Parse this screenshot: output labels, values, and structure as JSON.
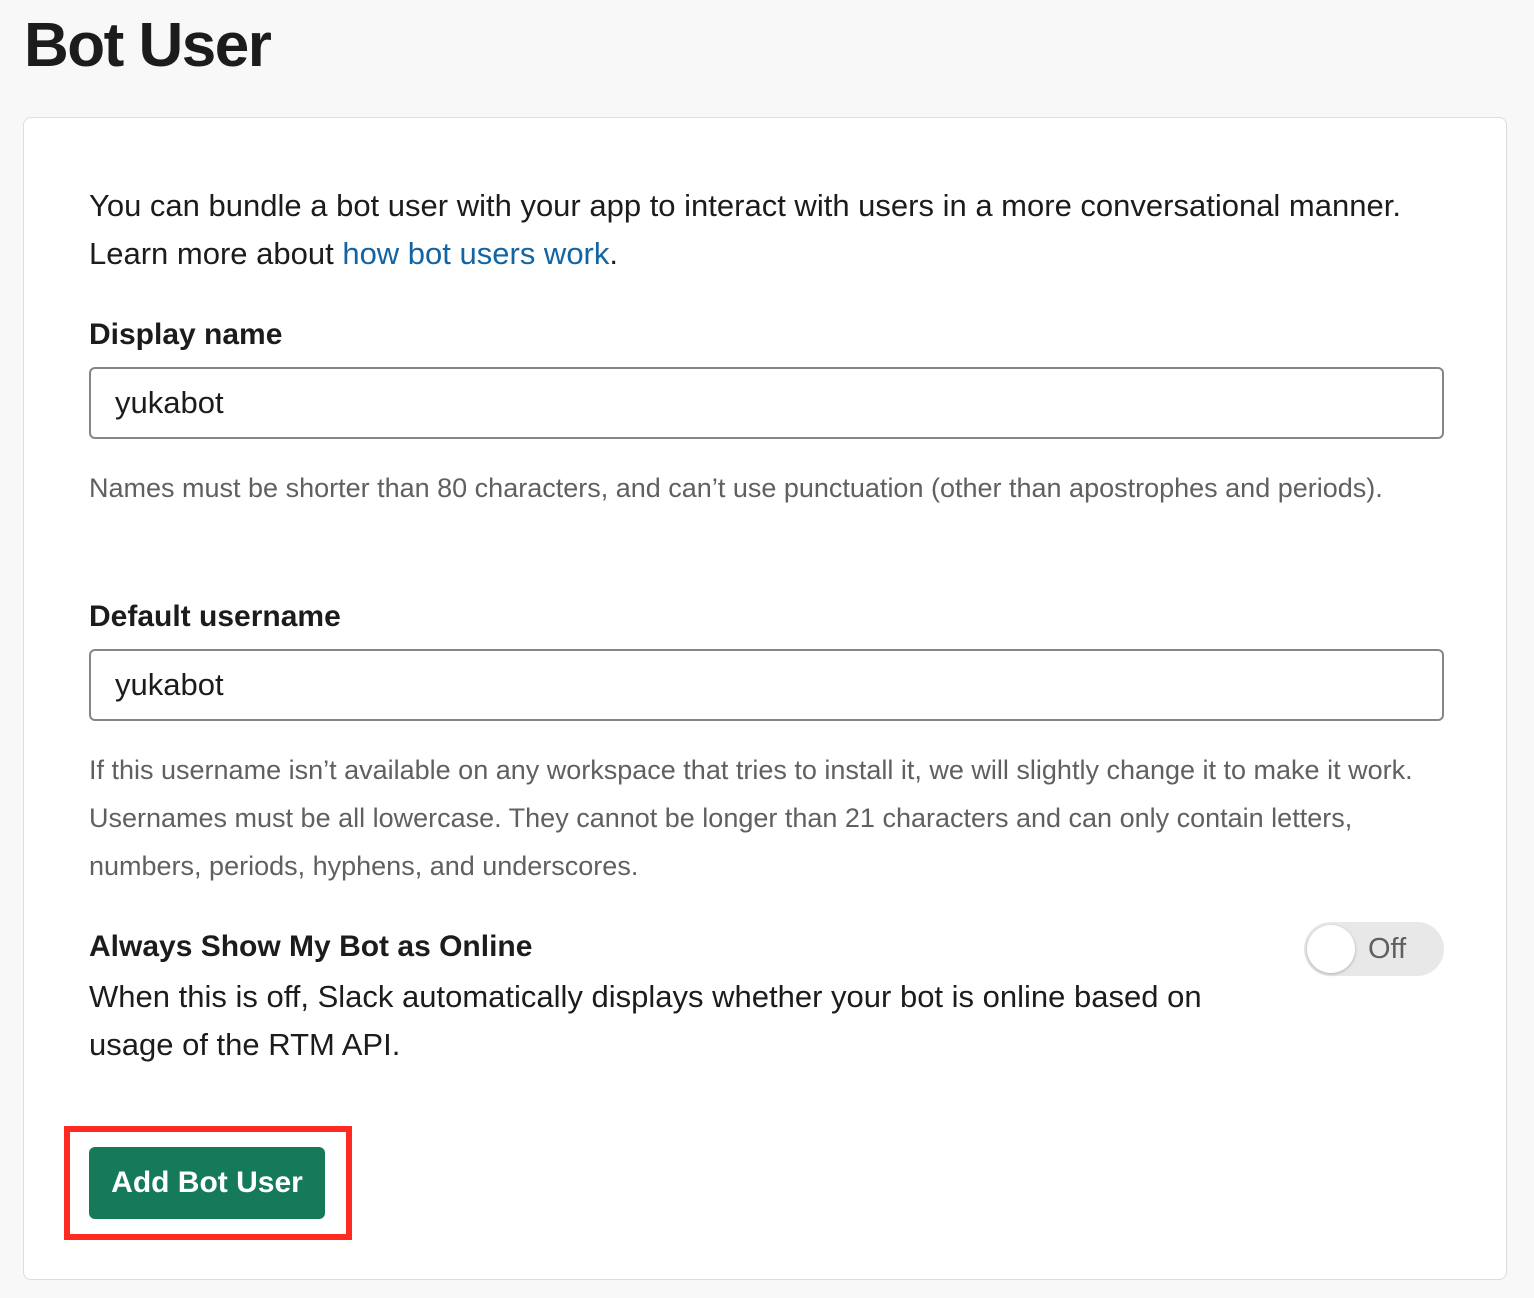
{
  "header": {
    "title": "Bot User"
  },
  "intro": {
    "text_before_link": "You can bundle a bot user with your app to interact with users in a more conversational manner. Learn more about ",
    "link_text": "how bot users work",
    "text_after_link": "."
  },
  "display_name": {
    "label": "Display name",
    "value": "yukabot",
    "hint": "Names must be shorter than 80 characters, and can’t use punctuation (other than apostrophes and periods)."
  },
  "default_username": {
    "label": "Default username",
    "value": "yukabot",
    "hint": "If this username isn’t available on any workspace that tries to install it, we will slightly change it to make it work. Usernames must be all lowercase. They cannot be longer than 21 characters and can only contain letters, numbers, periods, hyphens, and underscores."
  },
  "always_online": {
    "title": "Always Show My Bot as Online",
    "description": "When this is off, Slack automatically displays whether your bot is online based on usage of the RTM API.",
    "toggle_label": "Off",
    "enabled": false
  },
  "actions": {
    "add_button_label": "Add Bot User"
  },
  "colors": {
    "page_background": "#f8f8f8",
    "link": "#1264a3",
    "primary_button": "#157a5a",
    "highlight_outline": "#ff2a22"
  }
}
